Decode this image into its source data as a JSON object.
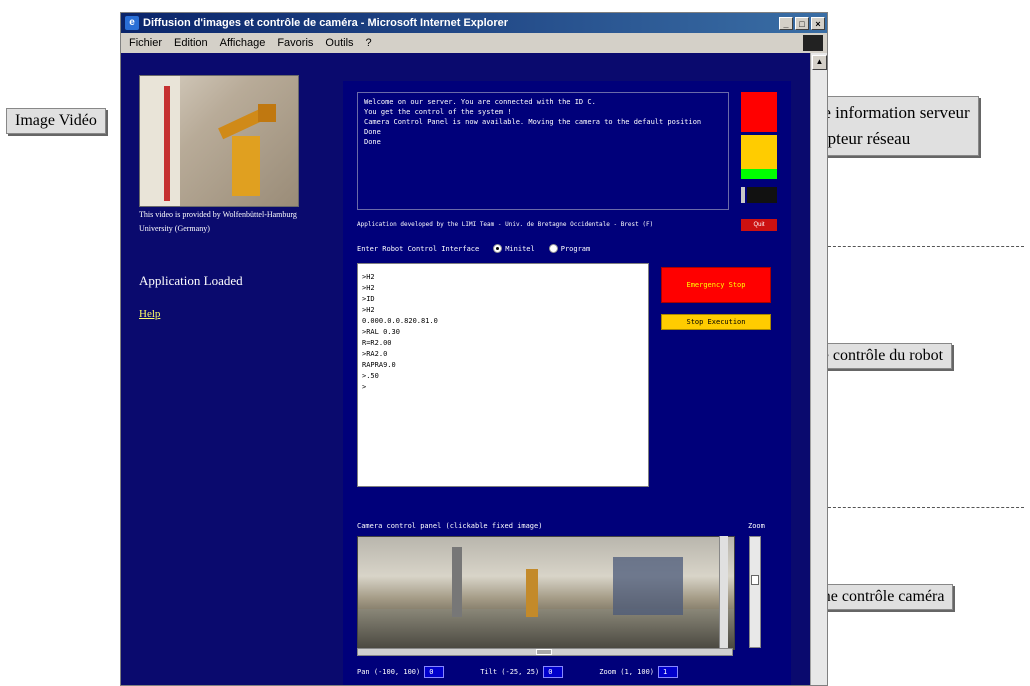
{
  "window": {
    "title": "Diffusion d'images et contrôle de caméra - Microsoft Internet Explorer",
    "menu": [
      "Fichier",
      "Edition",
      "Affichage",
      "Favoris",
      "Outils",
      "?"
    ]
  },
  "left": {
    "video_caption": "This video is provided by Wolfenbüttel-Hamburg University (Germany)",
    "app_status": "Application Loaded",
    "help_link": "Help"
  },
  "server": {
    "console_text": "Welcome on our server. You are connected with the ID C.\nYou get the control of the system !\nCamera Control Panel is now available. Moving the camera to the default position\nDone\nDone",
    "credit": "Application developed by the LIMI Team - Univ. de Bretagne Occidentale - Brest (F)",
    "quit_label": "Quit"
  },
  "robot": {
    "interface_label": "Enter Robot Control Interface",
    "mode_options": [
      "Minitel",
      "Program"
    ],
    "selected_mode": "Minitel",
    "command_lines": [
      ">H2",
      ">H2",
      ">ID",
      ">H2",
      "0.000.0.0.820.81.0",
      ">RAL 0.30",
      "R=R2.00",
      ">RA2.0",
      "RAPRA9.0",
      ">.50",
      ">"
    ],
    "emergency_label": "Emergency Stop",
    "stop_label": "Stop Execution"
  },
  "camera": {
    "panel_label": "Camera control panel (clickable fixed image)",
    "zoom_label": "Zoom",
    "pan_label": "Pan (-100, 100)",
    "pan_value": "0",
    "tilt_label": "Tilt (-25, 25)",
    "tilt_value": "0",
    "zoom_range_label": "Zoom (1, 100)",
    "zoom_value": "1"
  },
  "annotations": {
    "video": "Image Vidéo",
    "server_line1": "Zone information serveur",
    "server_line2": "et capteur réseau",
    "robot": "Zone contrôle du robot",
    "camera": "Zone contrôle caméra"
  },
  "colors": {
    "page_bg": "#0a0a6e",
    "status_red": "#ff0000",
    "status_yellow": "#ffcc00",
    "status_green": "#00ff00"
  }
}
